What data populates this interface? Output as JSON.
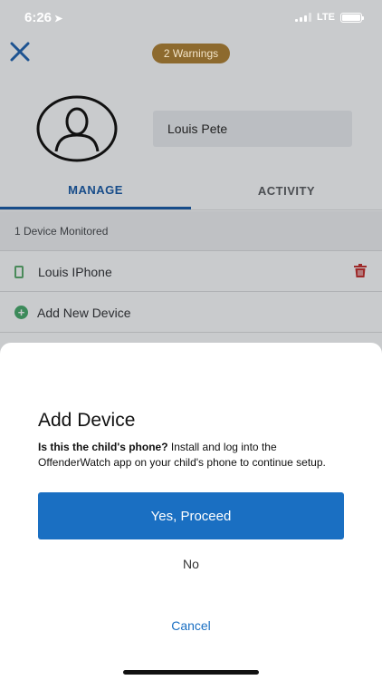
{
  "status_bar": {
    "time": "6:26",
    "network": "LTE"
  },
  "header": {
    "warnings_label": "2 Warnings"
  },
  "profile": {
    "name": "Louis Pete"
  },
  "tabs": [
    {
      "label": "MANAGE",
      "active": true
    },
    {
      "label": "ACTIVITY",
      "active": false
    }
  ],
  "devices": {
    "section_header": "1 Device Monitored",
    "items": [
      {
        "name": "Louis IPhone"
      }
    ],
    "add_label": "Add New Device"
  },
  "dialog": {
    "title": "Add Device",
    "question": "Is this the child's phone?",
    "instructions": "Install and log into the OffenderWatch app on your child's phone to continue setup.",
    "proceed_label": "Yes, Proceed",
    "no_label": "No",
    "cancel_label": "Cancel"
  },
  "colors": {
    "accent_blue": "#1a6fc2",
    "warning_badge": "#8d6a2e",
    "delete_red": "#9e2a2a",
    "device_green": "#3c8a5a"
  }
}
